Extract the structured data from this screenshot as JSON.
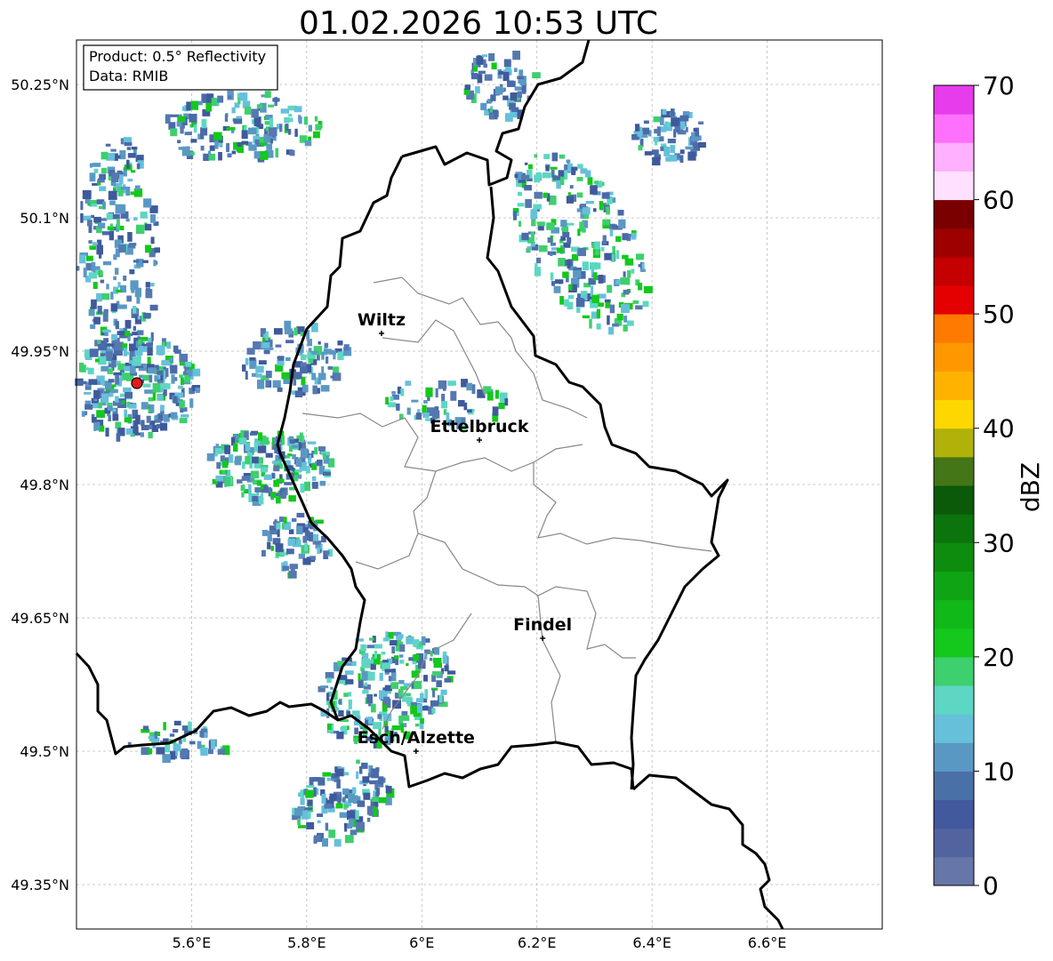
{
  "title": "01.02.2026 10:53 UTC",
  "info_box": {
    "product": "Product: 0.5° Reflectivity",
    "data": "Data: RMIB"
  },
  "map": {
    "lat_ticks": [
      {
        "value": 50.25,
        "label": "50.25°N"
      },
      {
        "value": 50.1,
        "label": "50.1°N"
      },
      {
        "value": 49.95,
        "label": "49.95°N"
      },
      {
        "value": 49.8,
        "label": "49.8°N"
      },
      {
        "value": 49.65,
        "label": "49.65°N"
      },
      {
        "value": 49.5,
        "label": "49.5°N"
      },
      {
        "value": 49.35,
        "label": "49.35°N"
      }
    ],
    "lon_ticks": [
      {
        "value": 5.6,
        "label": "5.6°E"
      },
      {
        "value": 5.8,
        "label": "5.8°E"
      },
      {
        "value": 6.0,
        "label": "6°E"
      },
      {
        "value": 6.2,
        "label": "6.2°E"
      },
      {
        "value": 6.4,
        "label": "6.4°E"
      },
      {
        "value": 6.6,
        "label": "6.6°E"
      }
    ],
    "extent": {
      "lon_min": 5.4,
      "lon_max": 6.8,
      "lat_min": 49.3,
      "lat_max": 50.3
    },
    "cities": [
      {
        "name": "Wiltz",
        "lon": 5.93,
        "lat": 49.97
      },
      {
        "name": "Ettelbruck",
        "lon": 6.1,
        "lat": 49.85
      },
      {
        "name": "Findel",
        "lon": 6.21,
        "lat": 49.627
      },
      {
        "name": "Esch/Alzette",
        "lon": 5.99,
        "lat": 49.5
      }
    ],
    "radar_site": {
      "lon": 5.505,
      "lat": 49.914,
      "color": "#e31a1c"
    },
    "grid": true
  },
  "colorbar": {
    "label": "dBZ",
    "tick_labels": [
      "0",
      "10",
      "20",
      "30",
      "40",
      "50",
      "60",
      "70"
    ],
    "min": 0,
    "max": 70,
    "colors": [
      "#6676a8",
      "#5264a0",
      "#42599e",
      "#4a70a8",
      "#5a98c4",
      "#66c0da",
      "#5ed6c4",
      "#3ecf6e",
      "#14c81c",
      "#10b818",
      "#0fa414",
      "#0e8c0e",
      "#0b740c",
      "#0a5a0a",
      "#447516",
      "#b0b20a",
      "#ffd700",
      "#ffb300",
      "#ff9800",
      "#ff7a00",
      "#e50000",
      "#c40000",
      "#9e0000",
      "#7a0000",
      "#ffe0ff",
      "#ffb0ff",
      "#ff70ff",
      "#e63ceb"
    ]
  }
}
